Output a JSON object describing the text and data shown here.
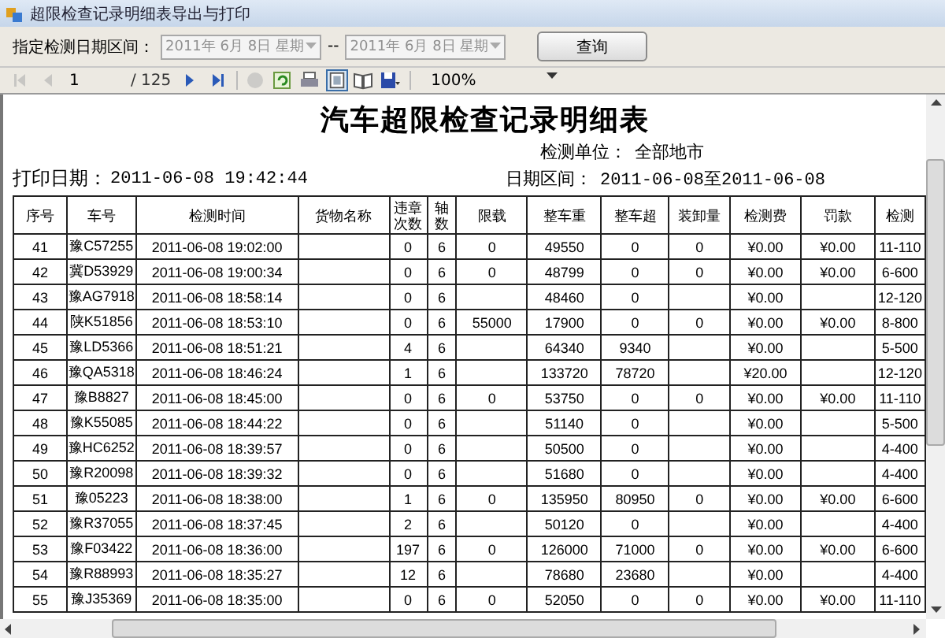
{
  "window": {
    "title": "超限检查记录明细表导出与打印"
  },
  "filter": {
    "label": "指定检测日期区间：",
    "date_from": {
      "value": "2011年  6月  8日  星期",
      "disabled": true
    },
    "separator": "--",
    "date_to": {
      "value": "2011年  6月  8日  星期",
      "disabled": true
    },
    "button": "查询"
  },
  "report_toolbar": {
    "nav": [
      {
        "kind": "first",
        "disabled": true
      },
      {
        "kind": "prev",
        "disabled": true
      }
    ],
    "page": "1",
    "page_total": "/ 125",
    "nav2": [
      {
        "kind": "next",
        "disabled": false
      },
      {
        "kind": "last",
        "disabled": false
      }
    ],
    "tools": [
      {
        "kind": "stop",
        "disabled": true,
        "selected": false
      },
      {
        "kind": "refresh",
        "disabled": false,
        "selected": false
      },
      {
        "kind": "print",
        "disabled": false,
        "selected": false
      },
      {
        "kind": "layout",
        "disabled": false,
        "selected": true
      },
      {
        "kind": "pagesetup",
        "disabled": false,
        "selected": false
      },
      {
        "kind": "save",
        "disabled": false,
        "selected": false
      }
    ],
    "zoom": "100%"
  },
  "report": {
    "title": "汽车超限检查记录明细表",
    "unit_label": "检测单位：",
    "unit": "全部地市",
    "range_label": "日期区间：",
    "range": "2011-06-08至2011-06-08",
    "print_label": "打印日期：",
    "print_date": "2011-06-08 19:42:44",
    "table": {
      "columns": [
        "序号",
        "车号",
        "检测时间",
        "货物名称",
        "违章次数",
        "轴数",
        "限载",
        "整车重",
        "整车超",
        "装卸量",
        "检测费",
        "罚款",
        "检测"
      ],
      "rows": [
        {
          "no": "41",
          "plate": "豫C57255",
          "time": "2011-06-08 19:02:00",
          "violations": "0",
          "axles": "6",
          "limit": "0",
          "gross": "49550",
          "over": "0",
          "unload": "0",
          "fee": "¥0.00",
          "fine": "¥0.00",
          "column_13": "11-110"
        },
        {
          "no": "42",
          "plate": "冀D53929",
          "time": "2011-06-08 19:00:34",
          "violations": "0",
          "axles": "6",
          "limit": "0",
          "gross": "48799",
          "over": "0",
          "unload": "0",
          "fee": "¥0.00",
          "fine": "¥0.00",
          "column_13": "6-600"
        },
        {
          "no": "43",
          "plate": "豫AG7918",
          "time": "2011-06-08 18:58:14",
          "violations": "0",
          "axles": "6",
          "gross": "48460",
          "over": "0",
          "fee": "¥0.00",
          "column_13": "12-120"
        },
        {
          "no": "44",
          "plate": "陕K51856",
          "time": "2011-06-08 18:53:10",
          "violations": "0",
          "axles": "6",
          "limit": "55000",
          "gross": "17900",
          "over": "0",
          "unload": "0",
          "fee": "¥0.00",
          "fine": "¥0.00",
          "column_13": "8-800"
        },
        {
          "no": "45",
          "plate": "豫LD5366",
          "time": "2011-06-08 18:51:21",
          "violations": "4",
          "axles": "6",
          "gross": "64340",
          "over": "9340",
          "fee": "¥0.00",
          "column_13": "5-500"
        },
        {
          "no": "46",
          "plate": "豫QA5318",
          "time": "2011-06-08 18:46:24",
          "violations": "1",
          "axles": "6",
          "gross": "133720",
          "over": "78720",
          "fee": "¥20.00",
          "column_13": "12-120"
        },
        {
          "no": "47",
          "plate": "豫B8827",
          "time": "2011-06-08 18:45:00",
          "violations": "0",
          "axles": "6",
          "limit": "0",
          "gross": "53750",
          "over": "0",
          "unload": "0",
          "fee": "¥0.00",
          "fine": "¥0.00",
          "column_13": "11-110"
        },
        {
          "no": "48",
          "plate": "豫K55085",
          "time": "2011-06-08 18:44:22",
          "violations": "0",
          "axles": "6",
          "gross": "51140",
          "over": "0",
          "fee": "¥0.00",
          "column_13": "5-500"
        },
        {
          "no": "49",
          "plate": "豫HC6252",
          "time": "2011-06-08 18:39:57",
          "violations": "0",
          "axles": "6",
          "gross": "50500",
          "over": "0",
          "fee": "¥0.00",
          "column_13": "4-400"
        },
        {
          "no": "50",
          "plate": "豫R20098",
          "time": "2011-06-08 18:39:32",
          "violations": "0",
          "axles": "6",
          "gross": "51680",
          "over": "0",
          "fee": "¥0.00",
          "column_13": "4-400"
        },
        {
          "no": "51",
          "plate": "豫05223",
          "time": "2011-06-08 18:38:00",
          "violations": "1",
          "axles": "6",
          "limit": "0",
          "gross": "135950",
          "over": "80950",
          "unload": "0",
          "fee": "¥0.00",
          "fine": "¥0.00",
          "column_13": "6-600"
        },
        {
          "no": "52",
          "plate": "豫R37055",
          "time": "2011-06-08 18:37:45",
          "violations": "2",
          "axles": "6",
          "gross": "50120",
          "over": "0",
          "fee": "¥0.00",
          "column_13": "4-400"
        },
        {
          "no": "53",
          "plate": "豫F03422",
          "time": "2011-06-08 18:36:00",
          "violations": "197",
          "axles": "6",
          "limit": "0",
          "gross": "126000",
          "over": "71000",
          "unload": "0",
          "fee": "¥0.00",
          "fine": "¥0.00",
          "column_13": "6-600"
        },
        {
          "no": "54",
          "plate": "豫R88993",
          "time": "2011-06-08 18:35:27",
          "violations": "12",
          "axles": "6",
          "gross": "78680",
          "over": "23680",
          "fee": "¥0.00",
          "column_13": "4-400"
        },
        {
          "no": "55",
          "plate": "豫J35369",
          "time": "2011-06-08 18:35:00",
          "violations": "0",
          "axles": "6",
          "limit": "0",
          "gross": "52050",
          "over": "0",
          "unload": "0",
          "fee": "¥0.00",
          "fine": "¥0.00",
          "column_13": "11-110"
        }
      ]
    }
  }
}
